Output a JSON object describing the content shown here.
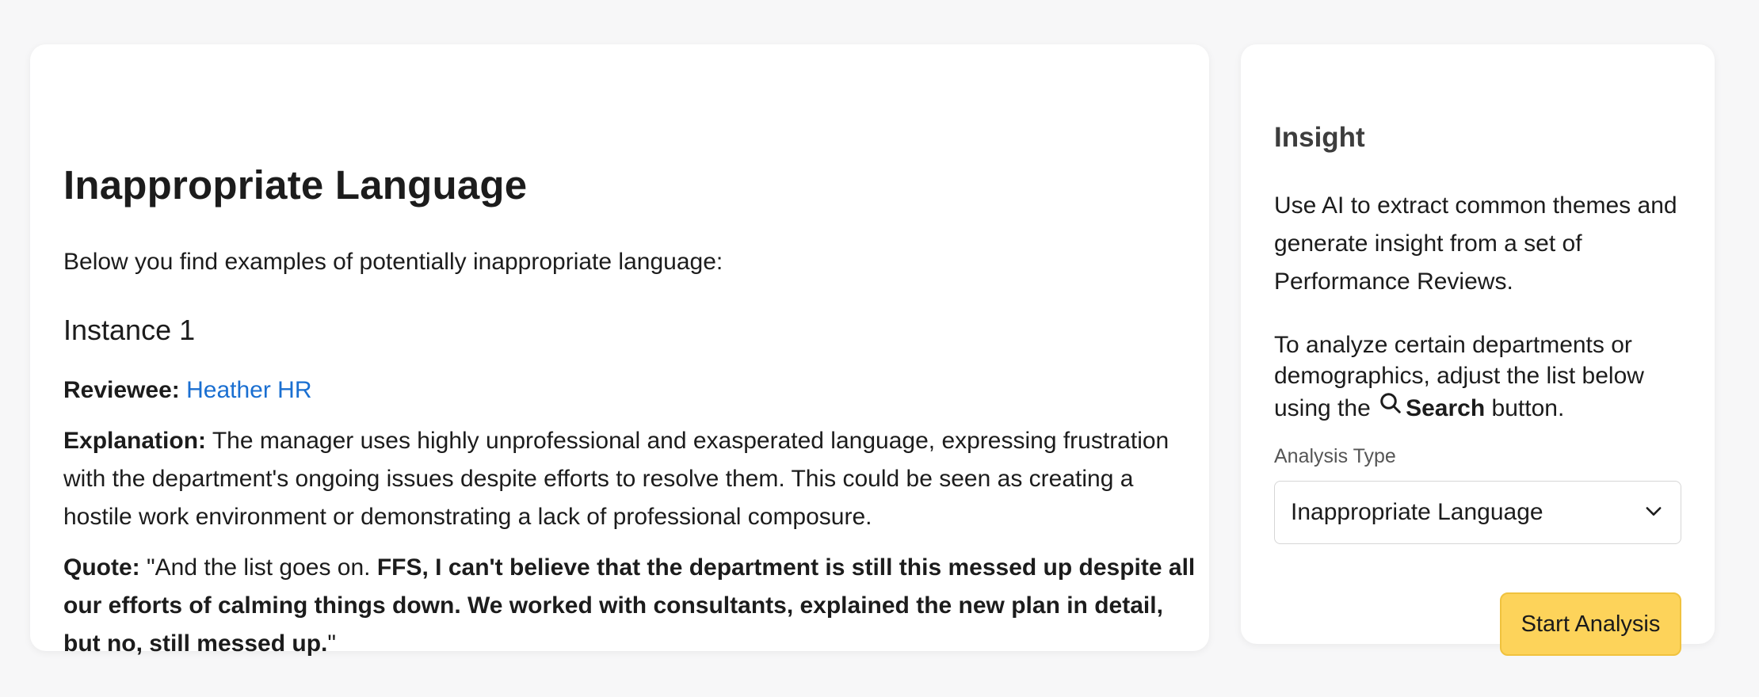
{
  "main": {
    "title": "Inappropriate Language",
    "intro": "Below you find examples of potentially inappropriate language:",
    "instance": {
      "heading": "Instance 1",
      "reviewee_label": "Reviewee:",
      "reviewee_name": "Heather HR",
      "explanation_label": "Explanation:",
      "explanation_text": "The manager uses highly unprofessional and exasperated language, expressing frustration with the department's ongoing issues despite efforts to resolve them. This could be seen as creating a hostile work environment or demonstrating a lack of professional composure.",
      "quote_label": "Quote:",
      "quote_open": "\"And the list goes on. ",
      "quote_bold": "FFS, I can't believe that the department is still this messed up despite all our efforts of calming things down. We worked with consultants, explained the new plan in detail, but no, still messed up.",
      "quote_close": "\""
    }
  },
  "insight": {
    "title": "Insight",
    "description": "Use AI to extract common themes and generate insight from a set of Performance Reviews.",
    "filter_text_before": "To analyze certain departments or demographics, adjust the list below using the",
    "search_label": "Search",
    "filter_text_after": "button.",
    "analysis_type_label": "Analysis Type",
    "analysis_type_value": "Inappropriate Language",
    "start_button": "Start Analysis"
  },
  "colors": {
    "link": "#1a6fd1",
    "button_bg": "#fdd35a",
    "page_bg": "#f7f7f8"
  }
}
